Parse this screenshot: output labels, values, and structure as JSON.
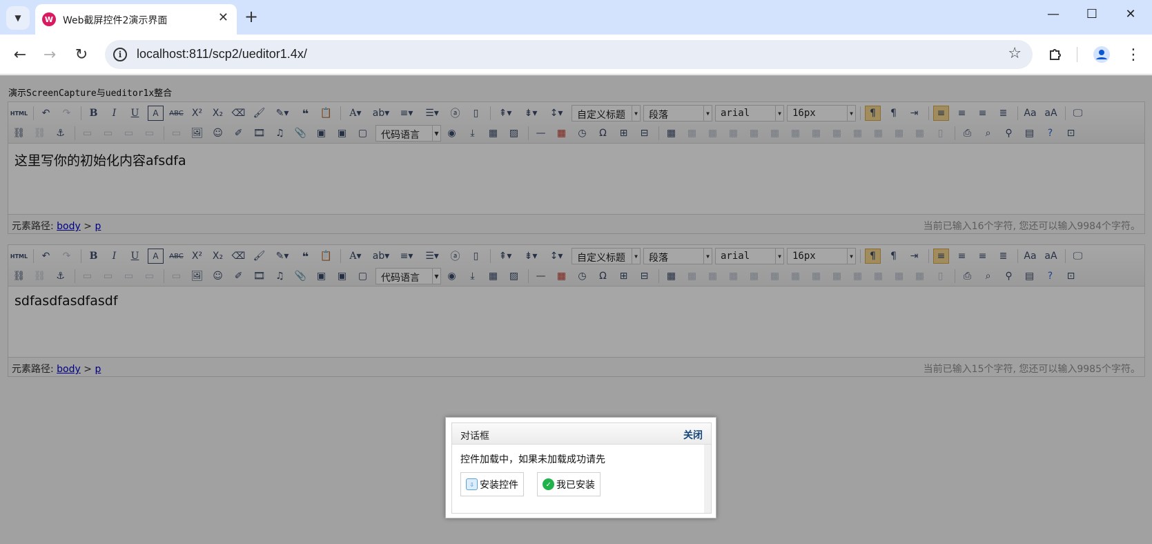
{
  "browser": {
    "tab_title": "Web截屏控件2演示界面",
    "favicon_text": "W",
    "url": "localhost:811/scp2/ueditor1.4x/",
    "icons": {
      "tab_search": "chevron-down-icon",
      "close_tab": "close-icon",
      "new_tab": "plus-icon",
      "back": "arrow-left-icon",
      "forward": "arrow-right-icon",
      "reload": "reload-icon",
      "site_info": "info-icon",
      "bookmark": "star-icon",
      "extensions": "puzzle-icon",
      "profile": "person-icon",
      "menu": "kebab-menu-icon"
    }
  },
  "page": {
    "heading": "演示ScreenCapture与ueditor1x整合"
  },
  "toolbar": {
    "custom_title": "自定义标题",
    "paragraph": "段落",
    "font_family": "arial",
    "font_size": "16px",
    "code_language": "代码语言",
    "html_label": "HTML"
  },
  "editors": [
    {
      "content": "这里写你的初始化内容afsdfa",
      "path_label": "元素路径:",
      "path_body": "body",
      "path_sep": ">",
      "path_p": "p",
      "word_count": "当前已输入16个字符, 您还可以输入9984个字符。"
    },
    {
      "content": "sdfasdfasdfasdf",
      "path_label": "元素路径:",
      "path_body": "body",
      "path_sep": ">",
      "path_p": "p",
      "word_count": "当前已输入15个字符, 您还可以输入9985个字符。"
    }
  ],
  "dialog": {
    "title": "对话框",
    "close": "关闭",
    "message": "控件加载中，如果未加载成功请先",
    "install_button": "安装控件",
    "installed_button": "我已安装"
  },
  "colors": {
    "tabbar": "#d3e3fd",
    "overlay": "rgba(0,0,0,0.35)",
    "link": "#0000cc",
    "dialog_close": "#15457a"
  }
}
